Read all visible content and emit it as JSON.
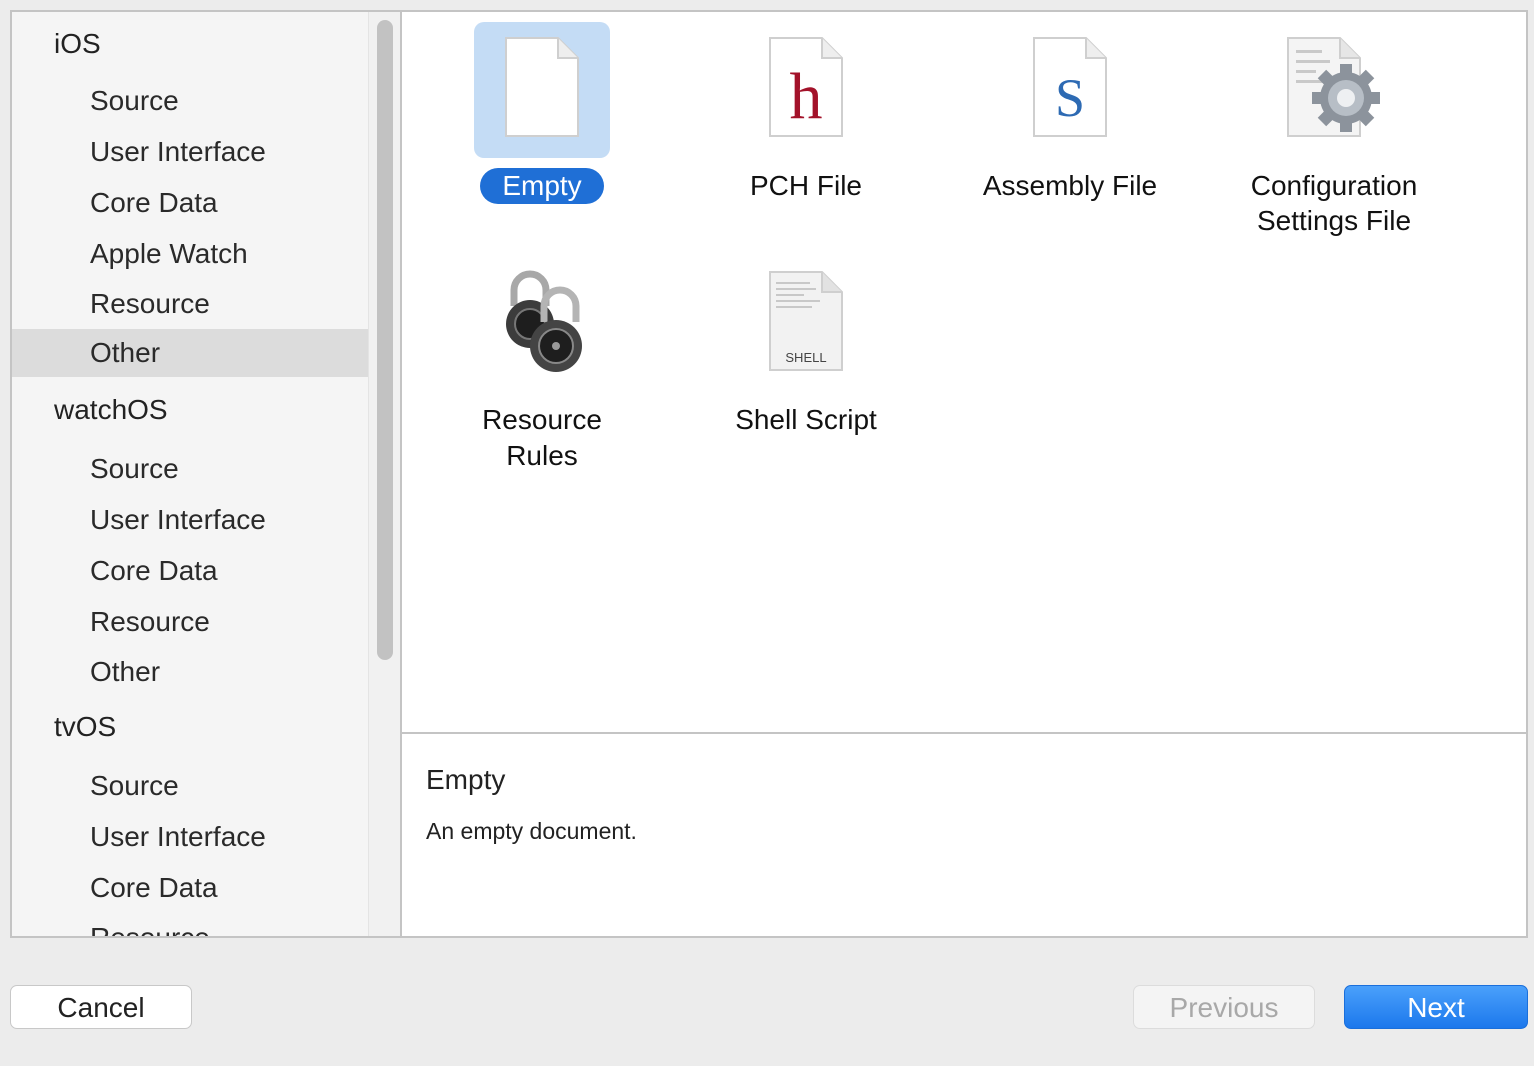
{
  "sidebar": {
    "groups": [
      {
        "title": "iOS",
        "items": [
          "Source",
          "User Interface",
          "Core Data",
          "Apple Watch",
          "Resource",
          "Other"
        ]
      },
      {
        "title": "watchOS",
        "items": [
          "Source",
          "User Interface",
          "Core Data",
          "Resource",
          "Other"
        ]
      },
      {
        "title": "tvOS",
        "items": [
          "Source",
          "User Interface",
          "Core Data",
          "Resource"
        ]
      }
    ],
    "selected": "Other"
  },
  "templates": [
    {
      "label": "Empty",
      "icon": "empty-document-icon",
      "selected": true
    },
    {
      "label": "PCH File",
      "icon": "pch-file-icon",
      "glyph": "h"
    },
    {
      "label": "Assembly File",
      "icon": "assembly-file-icon",
      "glyph": "S"
    },
    {
      "label_line1": "Configuration",
      "label_line2": "Settings File",
      "icon": "configuration-settings-icon"
    },
    {
      "label": "Resource Rules",
      "icon": "padlocks-icon"
    },
    {
      "label": "Shell Script",
      "icon": "shell-script-icon",
      "glyph": "SHELL"
    }
  ],
  "description": {
    "title": "Empty",
    "text": "An empty document."
  },
  "buttons": {
    "cancel": "Cancel",
    "previous": "Previous",
    "next": "Next"
  },
  "colors": {
    "accent": "#1f6fd6",
    "selection_tile": "#c4dcf5",
    "sidebar_selection": "#dcdcdc"
  }
}
